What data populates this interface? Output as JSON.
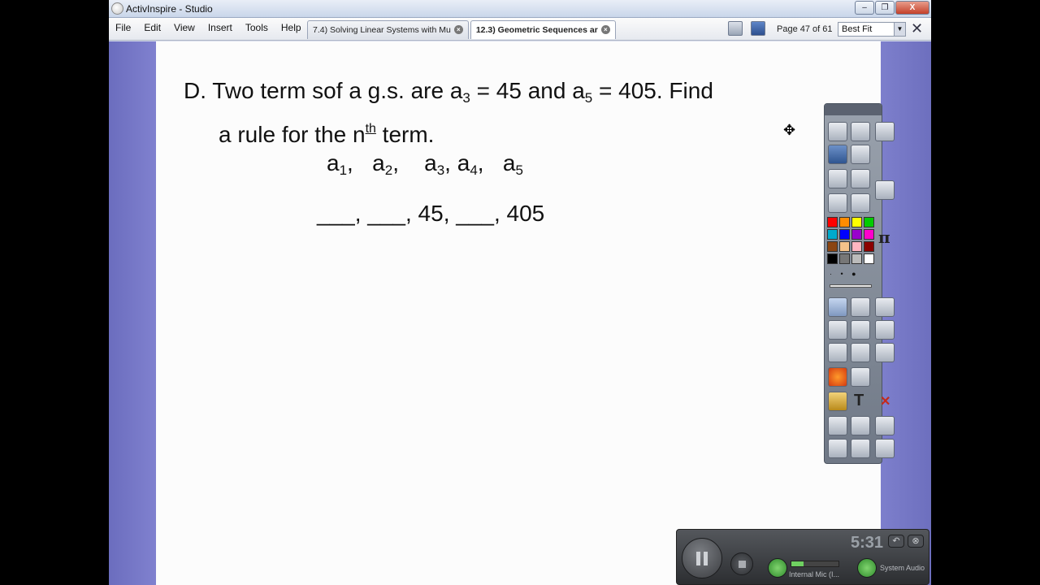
{
  "window": {
    "title": "ActivInspire - Studio",
    "close_label": "X"
  },
  "menu": [
    "File",
    "Edit",
    "View",
    "Insert",
    "Tools",
    "Help"
  ],
  "tabs": [
    {
      "label": "7.4) Solving Linear Systems with Mu",
      "active": false
    },
    {
      "label": "12.3) Geometric Sequences ar",
      "active": true
    }
  ],
  "toolbar": {
    "page_indicator": "Page 47 of 61",
    "zoom": "Best Fit"
  },
  "flipchart": {
    "problem_prefix": "D. Two term sof a g.s. are a",
    "a3_sub": "3",
    "a3_value": " = 45 and a",
    "a5_sub": "5",
    "a5_value": " = 405. Find",
    "line2_prefix": "a rule for the n",
    "line2_sup": "th",
    "line2_suffix": " term.",
    "terms": [
      {
        "base": "a",
        "sub": "1",
        "suffix": ",   "
      },
      {
        "base": "a",
        "sub": "2",
        "suffix": ",    "
      },
      {
        "base": "a",
        "sub": "3",
        "suffix": ", "
      },
      {
        "base": "a",
        "sub": "4",
        "suffix": ",   "
      },
      {
        "base": "a",
        "sub": "5",
        "suffix": ""
      }
    ],
    "values_line": "___, ___, 45, ___, 405"
  },
  "palette": {
    "colors": [
      "#ff0000",
      "#ff8c00",
      "#ffff00",
      "#00cc00",
      "#00aacc",
      "#0000ff",
      "#9900cc",
      "#ff00cc",
      "#8b4513",
      "#f4c28a",
      "#ffb6c1",
      "#8b0000",
      "#000000",
      "#777777",
      "#bbbbbb",
      "#ffffff"
    ],
    "pi_label": "π",
    "text_tool_label": "T",
    "delete_label": "✕"
  },
  "recorder": {
    "time": "5:31",
    "mic_label": "Internal Mic (I...",
    "system_audio_label": "System Audio",
    "mic_level": 0.25
  }
}
